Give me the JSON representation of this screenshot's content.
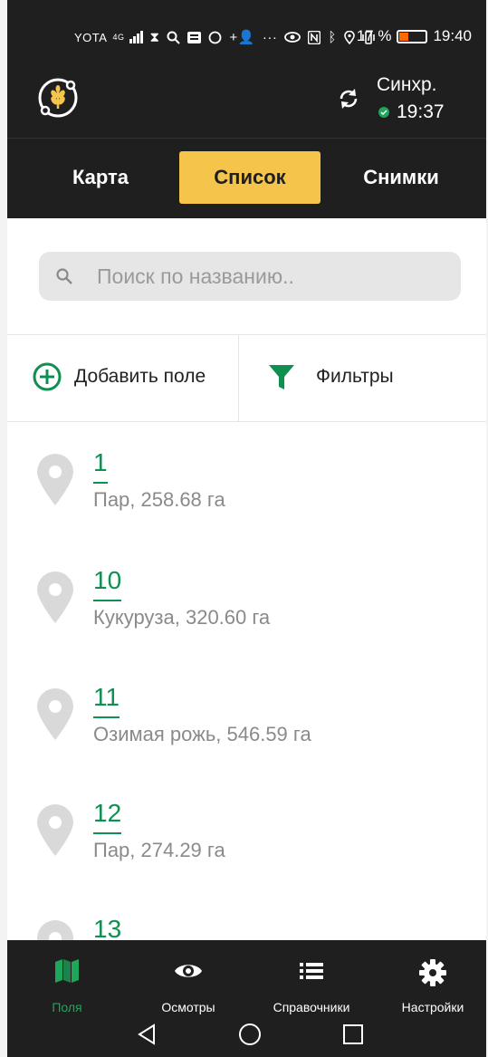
{
  "status_bar": {
    "carrier": "YOTA",
    "network": "4G",
    "battery_percent": "17 %",
    "time": "19:40",
    "battery_level": 0.17
  },
  "header": {
    "sync_title": "Синхр.",
    "sync_time": "19:37",
    "sync_status_color": "#1ea65a"
  },
  "tabs": [
    {
      "label": "Карта",
      "active": false
    },
    {
      "label": "Список",
      "active": true
    },
    {
      "label": "Снимки",
      "active": false
    }
  ],
  "search": {
    "placeholder": "Поиск по названию.."
  },
  "actions": {
    "add_label": "Добавить поле",
    "filter_label": "Фильтры"
  },
  "fields": [
    {
      "name": "1",
      "desc": "Пар, 258.68 га"
    },
    {
      "name": "10",
      "desc": "Кукуруза, 320.60 га"
    },
    {
      "name": "11",
      "desc": "Озимая рожь, 546.59 га"
    },
    {
      "name": "12",
      "desc": "Пар, 274.29 га"
    },
    {
      "name": "13",
      "desc": ""
    }
  ],
  "bottom_nav": [
    {
      "label": "Поля",
      "icon": "map-icon",
      "active": true
    },
    {
      "label": "Осмотры",
      "icon": "eye-icon",
      "active": false
    },
    {
      "label": "Справочники",
      "icon": "list-icon",
      "active": false
    },
    {
      "label": "Настройки",
      "icon": "gear-icon",
      "active": false
    }
  ],
  "colors": {
    "accent_green": "#0f8f50",
    "tab_active": "#f4c54a",
    "dark_bg": "#1f1f1f"
  }
}
